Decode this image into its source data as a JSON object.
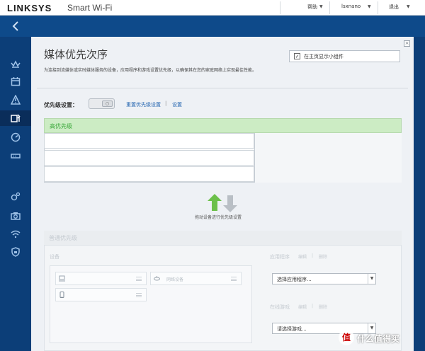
{
  "header": {
    "brand": "LINKSYS",
    "product": "Smart Wi-Fi",
    "help_label": "帮助",
    "user_label": "lsxnano",
    "logout_label": "退出"
  },
  "sidebar": {
    "back_icon": "chevron-left-icon",
    "items": [
      {
        "icon": "crown-icon"
      },
      {
        "icon": "calendar-icon"
      },
      {
        "icon": "warning-icon"
      },
      {
        "icon": "media-priority-icon",
        "active": true
      },
      {
        "icon": "speedometer-icon"
      },
      {
        "icon": "router-icon"
      },
      {
        "icon": "gears-icon"
      },
      {
        "icon": "camera-icon"
      },
      {
        "icon": "wifi-icon"
      },
      {
        "icon": "shield-icon"
      }
    ]
  },
  "page": {
    "title": "媒体优先次序",
    "description": "为连接到流媒体或实时媒体服务的设备，应用程序和游戏设置优先级，以确保其在您的家庭网络上实现最佳性能。",
    "show_widget_label": "在主页显示小组件",
    "show_widget_checked": true,
    "close_label": "×"
  },
  "priority": {
    "label": "优先级设置：",
    "toggle_state": "off",
    "reset_link": "重置优先级设置",
    "separator": "|",
    "settings_link": "设置"
  },
  "high_priority": {
    "header": "高优先级",
    "slots": [
      "",
      "",
      ""
    ]
  },
  "drag_hint": "拖动设备进行优先级设置",
  "normal_priority": {
    "header": "普通优先级",
    "devices_label": "设备",
    "devices": [
      {
        "name": "",
        "icon": "laptop-icon"
      },
      {
        "name": "网络设备",
        "icon": "network-device-icon"
      },
      {
        "name": "",
        "icon": "phone-icon"
      }
    ],
    "apps_label": "应用程序",
    "apps_edit": "编辑",
    "apps_delete": "删除",
    "apps_select": "选择应用程序...",
    "games_label": "在线游戏",
    "games_edit": "编辑",
    "games_delete": "删除",
    "games_select": "请选择游戏..."
  },
  "watermark": {
    "badge": "值",
    "text": "什么值得买"
  }
}
